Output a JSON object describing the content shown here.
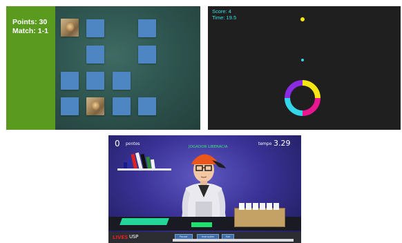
{
  "memory_game": {
    "points_text": "Points: 30",
    "match_text": "Match: 1-1",
    "colors": {
      "sidebar": "#5a9a1f",
      "card_back": "#4e86c4",
      "board": "#2f5650"
    },
    "cards_face_up": [
      "lion",
      "lion"
    ]
  },
  "color_switch": {
    "score_text": "Score: 4",
    "time_text": "Time: 19.5",
    "colors": {
      "background": "#1f1f1f",
      "ring": [
        "#f5e614",
        "#e8168f",
        "#33d6e8",
        "#8a2be2"
      ]
    }
  },
  "quiz_game": {
    "points_value": "0",
    "points_label": "pontos",
    "player_name": "JOGADOR LIBERACIA",
    "time_label": "tempo",
    "time_value": "3.29",
    "footer_logo": "LIVES",
    "footer_usp": "USP",
    "buttons": [
      "Pausar",
      "Instruções",
      "Sair"
    ]
  }
}
